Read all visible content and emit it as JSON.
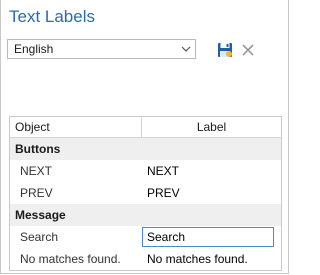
{
  "panel": {
    "title": "Text Labels"
  },
  "language": {
    "selected": "English"
  },
  "toolbar": {
    "save_icon": "save-icon",
    "delete_icon": "close-icon"
  },
  "grid": {
    "columns": [
      "Object",
      "Label"
    ],
    "groups": [
      {
        "name": "Buttons",
        "rows": [
          {
            "object": "NEXT",
            "label": "NEXT"
          },
          {
            "object": "PREV",
            "label": "PREV"
          }
        ]
      },
      {
        "name": "Message",
        "rows": [
          {
            "object": "Search",
            "label": "Search"
          },
          {
            "object": "No matches found.",
            "label": "No matches found."
          }
        ]
      }
    ]
  },
  "colors": {
    "title": "#2a6ca8",
    "save_icon": "#1e5fa8",
    "focus_border": "#4a8cd0"
  }
}
